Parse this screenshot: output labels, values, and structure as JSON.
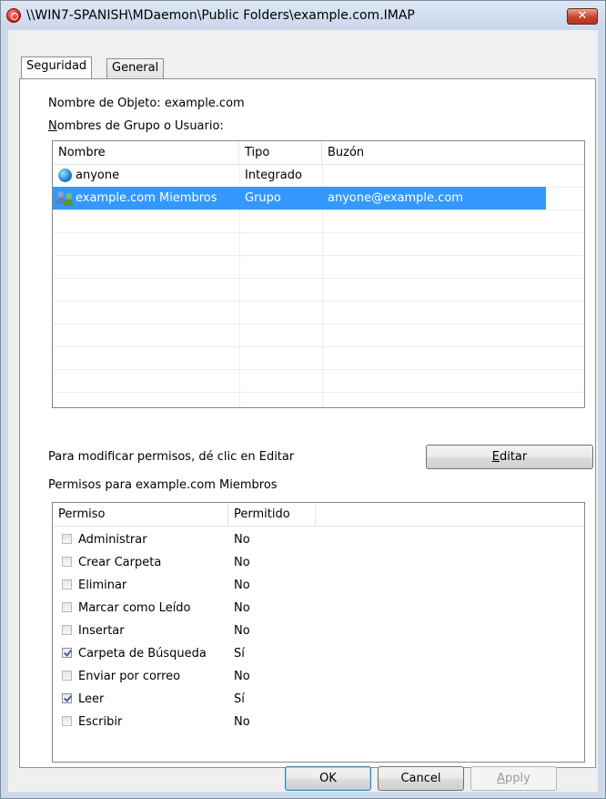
{
  "window": {
    "title": "\\\\WIN7-SPANISH\\MDaemon\\Public Folders\\example.com.IMAP",
    "close_glyph": "✕"
  },
  "tabs": [
    {
      "label": "Seguridad",
      "active": true
    },
    {
      "label": "General",
      "active": false
    }
  ],
  "security": {
    "object_name_label": "Nombre de Objeto:",
    "object_name_value": "example.com",
    "groups_label_first": "N",
    "groups_label_rest": "ombres de Grupo o Usuario:",
    "columns": [
      "Nombre",
      "Tipo",
      "Buzón"
    ],
    "principals": [
      {
        "name": "anyone",
        "type": "Integrado",
        "mailbox": "",
        "icon": "globe-icon",
        "selected": false
      },
      {
        "name": "example.com Miembros",
        "type": "Grupo",
        "mailbox": "anyone@example.com",
        "icon": "group-icon",
        "selected": true
      }
    ],
    "edit_hint": "Para modificar permisos, dé clic en Editar",
    "edit_button_first": "E",
    "edit_button_rest": "ditar",
    "permissions_label": "Permisos para  example.com Miembros",
    "perm_columns": [
      "Permiso",
      "Permitido"
    ],
    "permissions": [
      {
        "name": "Administrar",
        "allowed": "No",
        "checked": false
      },
      {
        "name": "Crear Carpeta",
        "allowed": "No",
        "checked": false
      },
      {
        "name": "Eliminar",
        "allowed": "No",
        "checked": false
      },
      {
        "name": "Marcar como Leído",
        "allowed": "No",
        "checked": false
      },
      {
        "name": "Insertar",
        "allowed": "No",
        "checked": false
      },
      {
        "name": "Carpeta de Búsqueda",
        "allowed": "Sí",
        "checked": true
      },
      {
        "name": "Enviar por correo",
        "allowed": "No",
        "checked": false
      },
      {
        "name": "Leer",
        "allowed": "Sí",
        "checked": true
      },
      {
        "name": "Escribir",
        "allowed": "No",
        "checked": false
      }
    ]
  },
  "footer": {
    "ok": "OK",
    "cancel": "Cancel",
    "apply_first": "A",
    "apply_rest": "pply"
  },
  "colors": {
    "selection": "#3399ff",
    "window_frame": "#ccd9ea",
    "dialog_bg": "#f0f0f0"
  }
}
